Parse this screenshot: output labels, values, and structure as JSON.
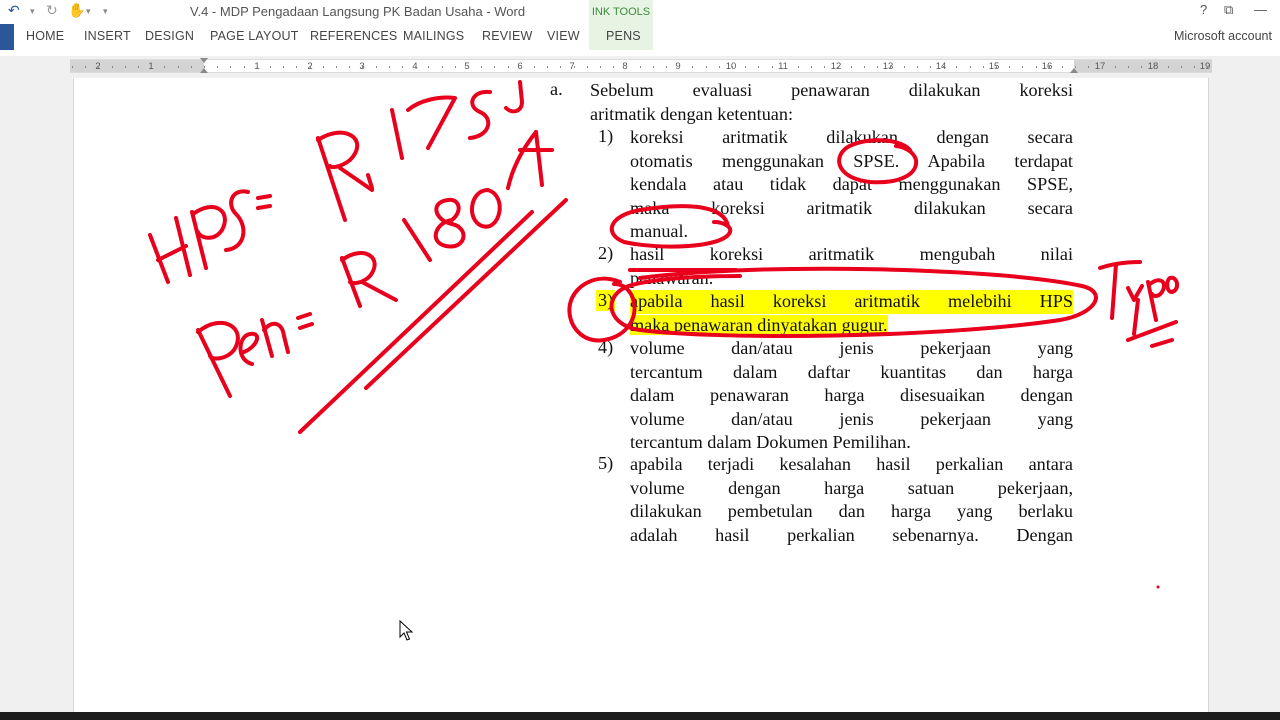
{
  "window": {
    "title": "V.4 - MDP Pengadaan Langsung PK Badan Usaha - Word",
    "contextual_group": "INK TOOLS",
    "account": "Microsoft account",
    "help": "?",
    "restore": "⧉",
    "minimize": "—"
  },
  "qat": {
    "undo": "↶",
    "redo": "↻",
    "touch": "✋",
    "customize": "▾"
  },
  "tabs": [
    {
      "label": "HOME"
    },
    {
      "label": "INSERT"
    },
    {
      "label": "DESIGN"
    },
    {
      "label": "PAGE LAYOUT"
    },
    {
      "label": "REFERENCES"
    },
    {
      "label": "MAILINGS"
    },
    {
      "label": "REVIEW"
    },
    {
      "label": "VIEW"
    },
    {
      "label": "PENS"
    }
  ],
  "ruler": {
    "left_numbers": [
      "2",
      "1"
    ],
    "right_numbers": [
      "1",
      "2",
      "3",
      "4",
      "5",
      "6",
      "7",
      "8",
      "9",
      "10",
      "11",
      "12",
      "13",
      "14",
      "15",
      "16",
      "17",
      "18",
      "19"
    ]
  },
  "document": {
    "item_a": {
      "marker": "a.",
      "lines": [
        "Sebelum evaluasi penawaran dilakukan koreksi",
        "aritmatik dengan ketentuan:"
      ]
    },
    "items": [
      {
        "marker": "1)",
        "lines": [
          "koreksi aritmatik dilakukan dengan secara",
          "otomatis menggunakan SPSE. Apabila terdapat",
          "kendala atau tidak dapat menggunakan SPSE,",
          "maka koreksi aritmatik dilakukan secara",
          "manual."
        ]
      },
      {
        "marker": "2)",
        "lines": [
          "hasil koreksi aritmatik mengubah nilai",
          "penawaran."
        ]
      },
      {
        "marker": "3)",
        "lines": [
          "apabila hasil koreksi aritmatik melebihi HPS",
          "maka penawaran dinyatakan gugur."
        ],
        "highlighted": true
      },
      {
        "marker": "4)",
        "lines": [
          "volume dan/atau jenis pekerjaan yang",
          "tercantum dalam daftar kuantitas dan harga",
          "dalam penawaran harga disesuaikan dengan",
          "volume dan/atau jenis pekerjaan yang",
          "tercantum dalam Dokumen Pemilihan."
        ]
      },
      {
        "marker": "5)",
        "lines": [
          "apabila terjadi  kesalahan hasil perkalian antara",
          "volume dengan harga satuan pekerjaan,",
          "dilakukan pembetulan dan harga yang berlaku",
          "adalah hasil perkalian sebenarnya. Dengan"
        ]
      }
    ]
  },
  "ink": {
    "color": "#e8001c",
    "handwritten_notes": [
      "HPS = Rp 175 JT",
      "Pen = Rp 180 JT",
      "Typo"
    ]
  },
  "colors": {
    "word_blue": "#2b579a",
    "ink_tools_green": "#3c8a3a",
    "highlight": "#ffff00"
  }
}
